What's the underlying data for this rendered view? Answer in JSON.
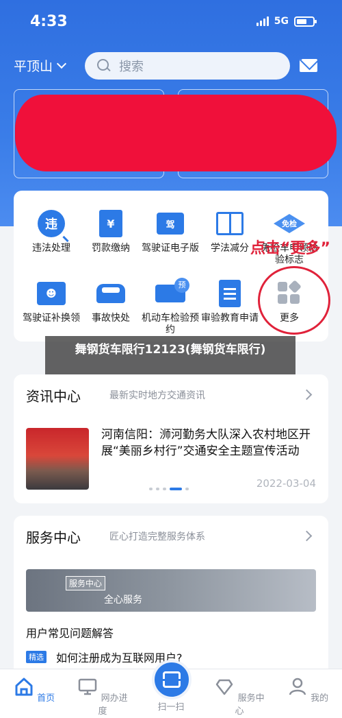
{
  "status_bar": {
    "time": "4:33",
    "network": "5G"
  },
  "header": {
    "city": "平顶山",
    "search_placeholder": "搜索"
  },
  "colors": {
    "brand": "#2c7ae6",
    "hero": "#3a7de8",
    "annotation": "#e0223a",
    "redaction": "#f0103a"
  },
  "services": [
    {
      "label": "违法处理",
      "icon": "violation-icon",
      "glyph": "违"
    },
    {
      "label": "罚款缴纳",
      "icon": "fine-payment-icon",
      "glyph": "¥"
    },
    {
      "label": "驾驶证电子版",
      "icon": "e-license-icon",
      "glyph": "驾"
    },
    {
      "label": "学法减分",
      "icon": "study-book-icon",
      "glyph": ""
    },
    {
      "label": "免检车申领检验标志",
      "icon": "inspection-exempt-icon",
      "glyph": "免检"
    },
    {
      "label": "驾驶证补换领",
      "icon": "license-replace-icon",
      "glyph": ""
    },
    {
      "label": "事故快处",
      "icon": "accident-car-icon",
      "glyph": ""
    },
    {
      "label": "机动车检验预约",
      "icon": "vehicle-inspect-icon",
      "glyph": "预"
    },
    {
      "label": "审验教育申请",
      "icon": "review-doc-icon",
      "glyph": ""
    },
    {
      "label": "更多",
      "icon": "more-grid-icon",
      "glyph": ""
    }
  ],
  "annotation": {
    "text": "点击“更多”"
  },
  "overlay_caption": "舞钢货车限行12123(舞钢货车限行)",
  "news": {
    "title": "资讯中心",
    "subtitle": "最新实时地方交通资讯",
    "headline": "河南信阳：浉河勤务大队深入农村地区开展“美丽乡村行”交通安全主题宣传活动",
    "date": "2022-03-04"
  },
  "service_center": {
    "title": "服务中心",
    "subtitle": "匠心打造完整服务体系",
    "banner_tag": "服务中心",
    "banner_text": "全心服务",
    "faq_label": "用户常见问题解答",
    "featured_badge": "精选",
    "featured_text": "如何注册成为互联网用户?"
  },
  "tabs": [
    {
      "label": "首页",
      "icon": "home-icon",
      "active": true
    },
    {
      "label": "网办进度",
      "icon": "monitor-icon",
      "active": false
    },
    {
      "label": "扫一扫",
      "icon": "scan-icon",
      "active": false
    },
    {
      "label": "服务中心",
      "icon": "service-icon",
      "active": false
    },
    {
      "label": "我的",
      "icon": "user-icon",
      "active": false
    }
  ]
}
